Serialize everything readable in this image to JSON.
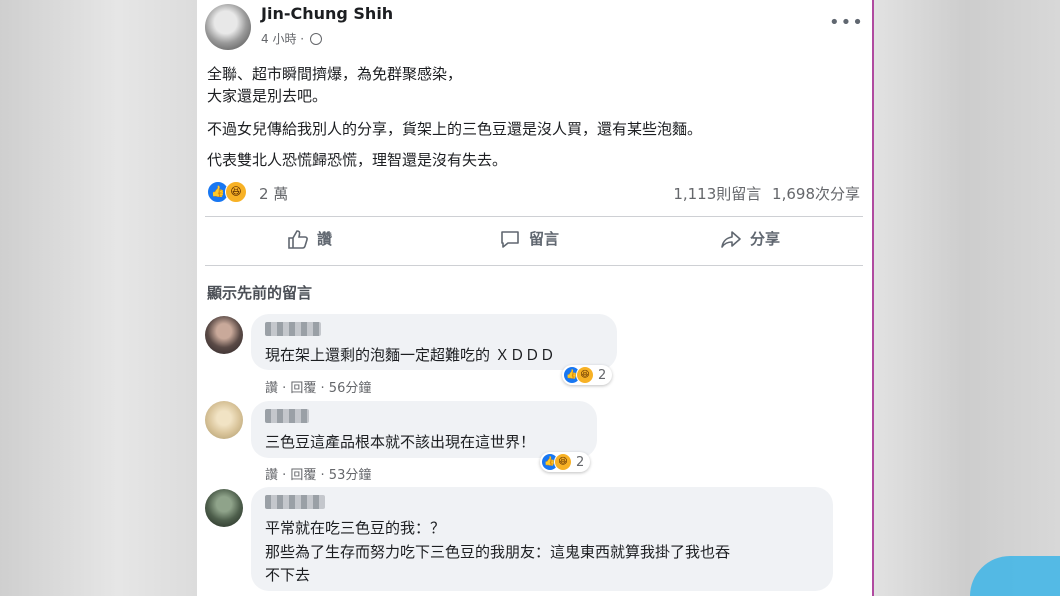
{
  "author": {
    "name": "Jin-Chung Shih",
    "time": "4 小時 ·"
  },
  "post": {
    "lines": [
      "全聯、超市瞬間擠爆，為免群聚感染，",
      "大家還是別去吧。",
      "不過女兒傳給我別人的分享，貨架上的三色豆還是沒人買，還有某些泡麵。",
      "代表雙北人恐慌歸恐慌，理智還是沒有失去。"
    ],
    "reaction_count": "2 萬",
    "comments_count": "1,113則留言",
    "shares_count": "1,698次分享"
  },
  "actions": {
    "like": "讚",
    "comment": "留言",
    "share": "分享"
  },
  "previous_comments": "顯示先前的留言",
  "comments": [
    {
      "lines": [
        "現在架上還剩的泡麵一定超難吃的 ＸＤＤＤ"
      ],
      "actions": "讚 · 回覆 · 56分鐘",
      "reactions": "2"
    },
    {
      "lines": [
        "三色豆這產品根本就不該出現在這世界！"
      ],
      "actions": "讚 · 回覆 · 53分鐘",
      "reactions": "2"
    },
    {
      "lines": [
        "平常就在吃三色豆的我：？",
        "那些為了生存而努力吃下三色豆的我朋友：這鬼東西就算我掛了我也吞",
        "不下去"
      ]
    }
  ],
  "colors": {
    "accent": "#1877f2",
    "haha": "#f7b125"
  }
}
